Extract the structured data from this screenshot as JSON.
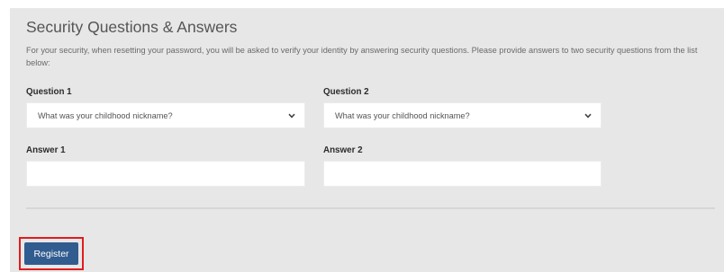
{
  "security": {
    "title": "Security Questions & Answers",
    "intro": "For your security, when resetting your password, you will be asked to verify your identity by answering security questions. Please provide answers to two security questions from the list below:",
    "question1": {
      "label": "Question 1",
      "selected": "What was your childhood nickname?",
      "icon": "chevron-down-icon"
    },
    "question2": {
      "label": "Question 2",
      "selected": "What was your childhood nickname?",
      "icon": "chevron-down-icon"
    },
    "answer1": {
      "label": "Answer 1",
      "value": ""
    },
    "answer2": {
      "label": "Answer 2",
      "value": ""
    }
  },
  "actions": {
    "register_label": "Register"
  },
  "colors": {
    "panel_bg": "#e7e7e7",
    "button_bg": "#315c8f",
    "highlight": "#e01c1c"
  }
}
